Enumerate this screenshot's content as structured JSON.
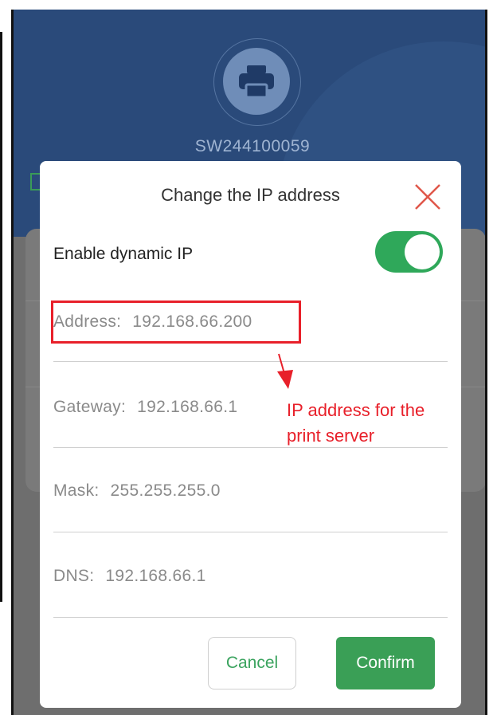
{
  "device": {
    "name": "SW244100059",
    "icon": "printer-icon"
  },
  "dialog": {
    "title": "Change the IP address",
    "close_icon": "close-icon",
    "dynamic_ip_label": "Enable dynamic IP",
    "dynamic_ip_enabled": true,
    "fields": {
      "address": {
        "label": "Address:",
        "value": "192.168.66.200"
      },
      "gateway": {
        "label": "Gateway:",
        "value": "192.168.66.1"
      },
      "mask": {
        "label": "Mask:",
        "value": "255.255.255.0"
      },
      "dns": {
        "label": "DNS:",
        "value": "192.168.66.1"
      }
    },
    "cancel_label": "Cancel",
    "confirm_label": "Confirm"
  },
  "annotation": {
    "line1": "IP address for the",
    "line2": "print server"
  },
  "colors": {
    "header": "#2a4a7a",
    "accent": "#3a9f56",
    "annotation": "#e8202a"
  }
}
